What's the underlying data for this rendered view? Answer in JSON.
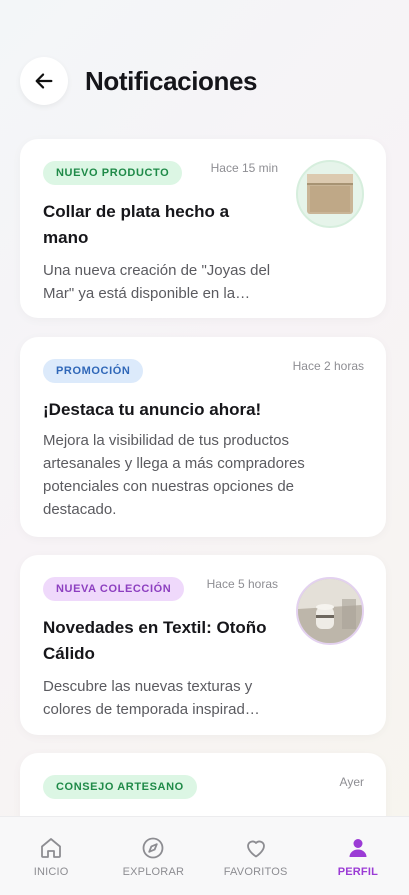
{
  "header": {
    "title": "Notificaciones"
  },
  "notifications": [
    {
      "badge": "NUEVO PRODUCTO",
      "time": "Hace 15 min",
      "title": "Collar de plata hecho a mano",
      "body": "Una nueva creación de \"Joyas del Mar\" ya está disponible en la…"
    },
    {
      "badge": "PROMOCIÓN",
      "time": "Hace 2 horas",
      "title": "¡Destaca tu anuncio ahora!",
      "body": "Mejora la visibilidad de tus productos artesanales y llega a más compradores potenciales con nuestras opciones de destacado."
    },
    {
      "badge": "NUEVA COLECCIÓN",
      "time": "Hace 5 horas",
      "title": "Novedades en Textil: Otoño Cálido",
      "body": "Descubre las nuevas texturas y colores de temporada inspirad…"
    },
    {
      "badge": "CONSEJO ARTESANO",
      "time": "Ayer",
      "title": "",
      "body": ""
    }
  ],
  "nav": {
    "items": [
      {
        "label": "INICIO",
        "icon": "home-icon"
      },
      {
        "label": "EXPLORAR",
        "icon": "compass-icon"
      },
      {
        "label": "FAVORITOS",
        "icon": "heart-icon"
      },
      {
        "label": "PERFIL",
        "icon": "user-icon"
      }
    ],
    "active": "PERFIL"
  },
  "colors": {
    "accent": "#9b3bd5",
    "badge_green": "#1f8a48",
    "badge_blue": "#2f67b8",
    "badge_purple": "#8d3fc0"
  }
}
